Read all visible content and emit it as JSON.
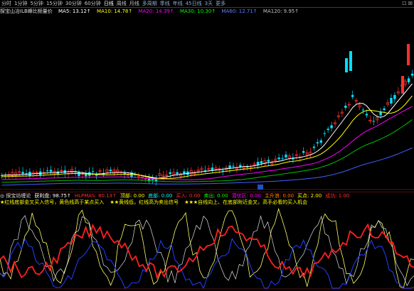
{
  "tabbar": {
    "tabs": [
      "分时",
      "1分钟",
      "5分钟",
      "15分钟",
      "30分钟",
      "60分钟",
      "日线",
      "周线",
      "月线",
      "多周期",
      "季线",
      "年线",
      "45日线",
      "3天",
      "更多"
    ],
    "active": "日线",
    "window_icons": "☐ ☒"
  },
  "main_header": {
    "title": "探宝山冶ILB峰比频量价",
    "ma5": "MA5: 13.12↑",
    "ma10": "MA10: 14.78↑",
    "ma20": "MA20: 14.39↑",
    "ma30": "MA30: 10.30↑",
    "ma60": "MA60: 12.71↑",
    "ma120": "MA120: 9.95↑"
  },
  "sub_header": {
    "title": "探宝坊缠论",
    "items": [
      {
        "label": "获利盘:",
        "value": "98.75↑",
        "color": "#ffffff"
      },
      {
        "label": "HLPMAS:",
        "value": "80.13↑",
        "color": "#ff3030"
      },
      {
        "label": "顶部:",
        "value": "0.00",
        "color": "#ffff00"
      },
      {
        "label": "底部:",
        "value": "0.00",
        "color": "#00ffff"
      },
      {
        "label": "买入:",
        "value": "0.00",
        "color": "#ff3030"
      },
      {
        "label": "卖出:",
        "value": "0.00",
        "color": "#00ff00"
      },
      {
        "label": "潜伏区:",
        "value": "0.00",
        "color": "#ff00ff"
      },
      {
        "label": "主升浪:",
        "value": "0.00",
        "color": "#ff8000"
      },
      {
        "label": "买点:",
        "value": "2.00",
        "color": "#ffff00"
      },
      {
        "label": "成功:",
        "value": "1.00",
        "color": "#ff3030"
      }
    ]
  },
  "legend": {
    "l1": "★红线底部金叉买入信号，黄色线高于某点买入",
    "l2": "★★黄线低，红线高为卖出信号",
    "l3": "★★★自线向上、在底部附近金叉，高手必看的买入机会"
  },
  "colors": {
    "up": "#ff3030",
    "down": "#00e0ff",
    "ma5": "#ffffff",
    "ma10": "#ffff00",
    "ma20": "#ff00ff",
    "ma30": "#00c000",
    "ma60": "#4060ff",
    "yellow_line": "#ffff66",
    "red_line": "#ff2020",
    "blue_line": "#2040ff"
  }
}
